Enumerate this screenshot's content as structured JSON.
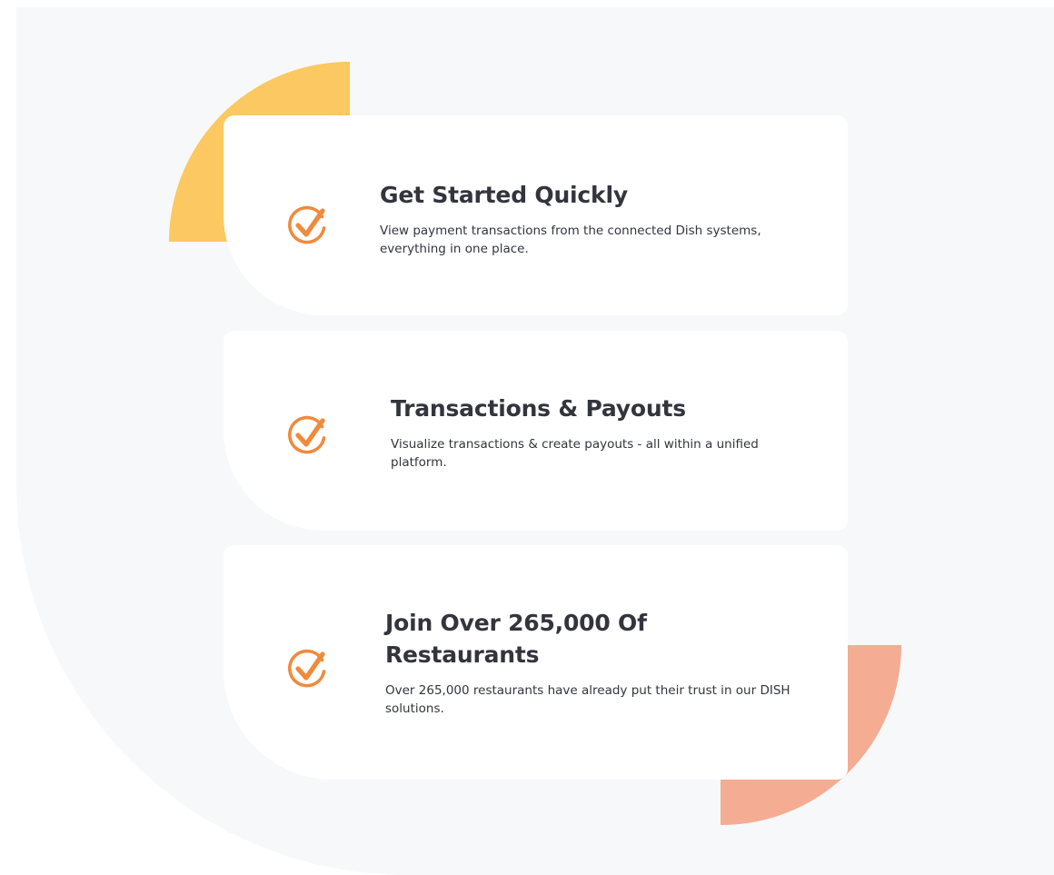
{
  "colors": {
    "background_panel": "#f7f8fa",
    "card": "#ffffff",
    "accent_orange": "#f08a3c",
    "deco_yellow": "#fcc862",
    "deco_salmon": "#f4ad93",
    "text": "#33353d"
  },
  "features": [
    {
      "icon": "check-circle-icon",
      "title": "Get Started Quickly",
      "description": "View payment transactions from the connected Dish systems, everything in one place."
    },
    {
      "icon": "check-circle-icon",
      "title": "Transactions & Payouts",
      "description": "Visualize transactions & create payouts - all within a unified platform."
    },
    {
      "icon": "check-circle-icon",
      "title": "Join Over 265,000 Of Restaurants",
      "description": "Over 265,000 restaurants have already put their trust in our DISH solutions."
    }
  ]
}
